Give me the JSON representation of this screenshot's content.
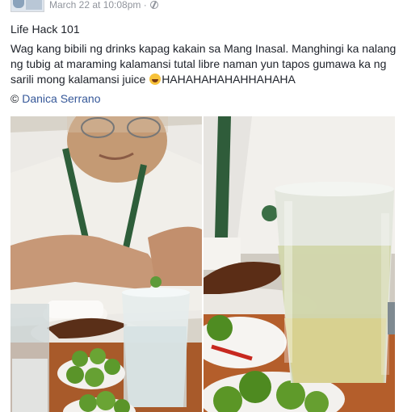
{
  "post": {
    "timestamp": "March 22 at 10:08pm",
    "title": "Life Hack 101",
    "body_before_emoji": "Wag kang bibili ng drinks kapag kakain sa Mang Inasal. Manghingi ka nalang ng tubig at maraming kalamansi tutal libre naman yun tapos gumawa ka ng sarili mong kalamansi juice",
    "body_after_emoji": "HAHAHAHAHAHHAHAHA",
    "credit_symbol": "©",
    "credit_name": "Danica Serrano"
  },
  "icons": {
    "privacy": "globe-icon",
    "emoji": "laughing-face-emoji"
  }
}
